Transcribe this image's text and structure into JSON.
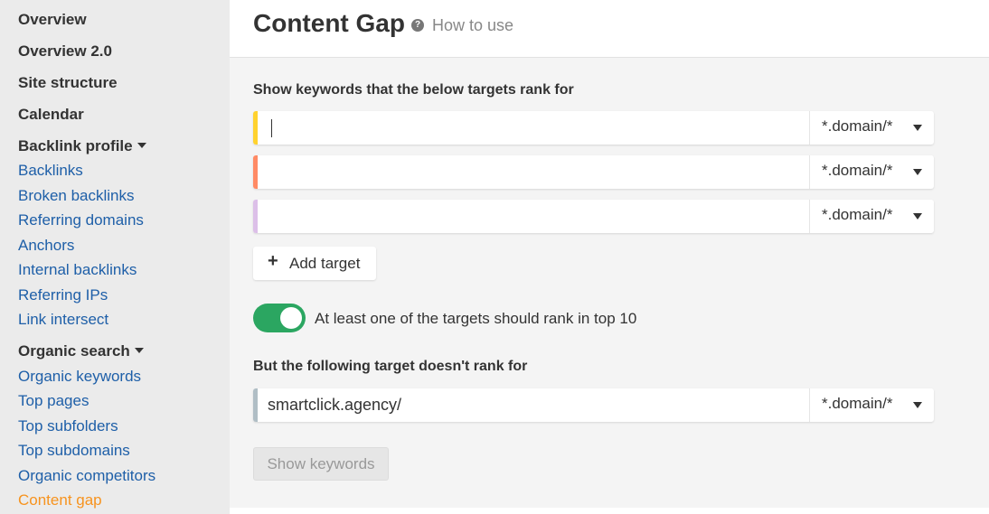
{
  "sidebar": {
    "top_items": [
      "Overview",
      "Overview 2.0",
      "Site structure",
      "Calendar"
    ],
    "sections": [
      {
        "title": "Backlink profile",
        "links": [
          "Backlinks",
          "Broken backlinks",
          "Referring domains",
          "Anchors",
          "Internal backlinks",
          "Referring IPs",
          "Link intersect"
        ]
      },
      {
        "title": "Organic search",
        "links": [
          "Organic keywords",
          "Top pages",
          "Top subfolders",
          "Top subdomains",
          "Organic competitors",
          "Content gap"
        ]
      }
    ],
    "active_item": "Content gap",
    "active_color": "#f7931e",
    "link_color": "#1e5fa8"
  },
  "header": {
    "title": "Content Gap",
    "help_icon": "question-circle-icon",
    "how_to_use": "How to use"
  },
  "form": {
    "targets_label": "Show keywords that the below targets rank for",
    "targets": [
      {
        "value": "",
        "mode": "*.domain/*",
        "accent": "#ffd22e",
        "focused": true
      },
      {
        "value": "",
        "mode": "*.domain/*",
        "accent": "#ff8a65"
      },
      {
        "value": "",
        "mode": "*.domain/*",
        "accent": "#dcbfe8"
      }
    ],
    "add_target": "Add target",
    "toggle": {
      "on": true,
      "label": "At least one of the targets should rank in top 10",
      "color": "#2ba661"
    },
    "exclude_label": "But the following target doesn't rank for",
    "exclude_target": {
      "value": "smartclick.agency/",
      "mode": "*.domain/*",
      "accent": "#b0bec5"
    },
    "submit": {
      "label": "Show keywords",
      "disabled": true
    }
  }
}
